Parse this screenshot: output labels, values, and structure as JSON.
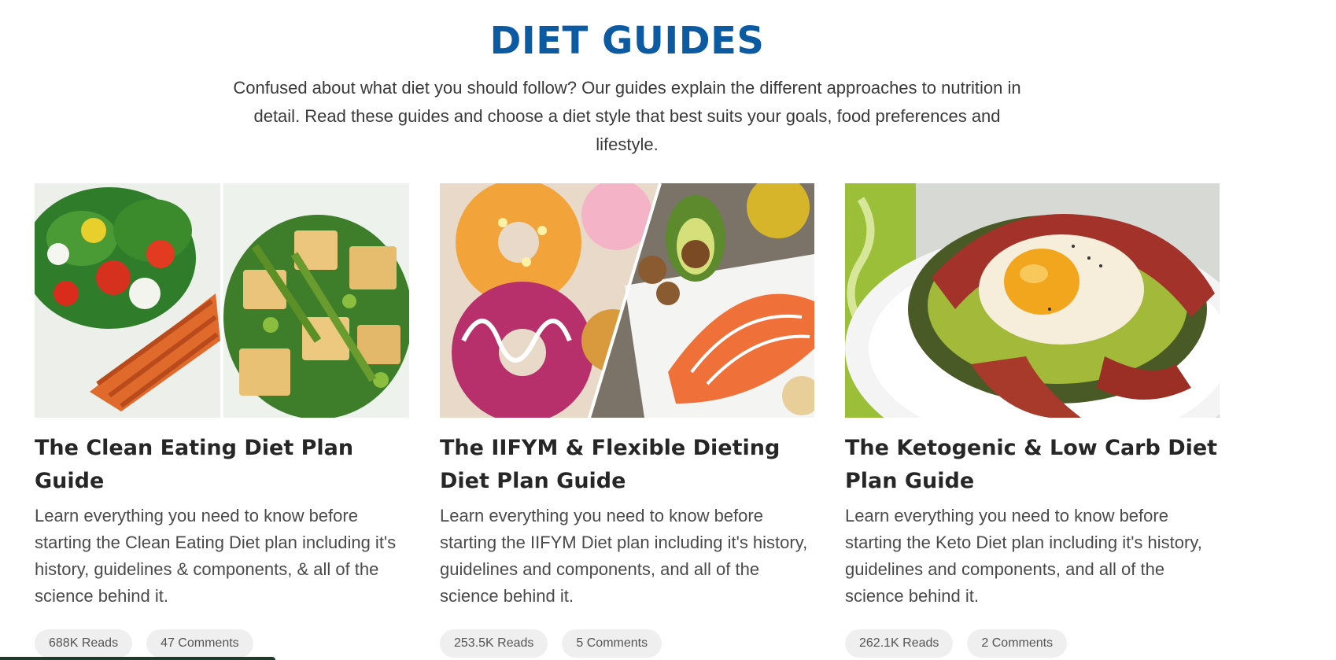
{
  "header": {
    "title": "DIET GUIDES",
    "intro": "Confused about what diet you should follow? Our guides explain the different approaches to nutrition in detail. Read these guides and choose a diet style that best suits your goals, food preferences and lifestyle."
  },
  "cards": [
    {
      "title": "The Clean Eating Diet Plan Guide",
      "description": "Learn everything you need to know before starting the Clean Eating Diet plan including it's history, guidelines & components, & all of the science behind it.",
      "reads": "688K Reads",
      "comments": "47 Comments",
      "image_icon": "salmon-salad-tofu-photo"
    },
    {
      "title": "The IIFYM & Flexible Dieting Diet Plan Guide",
      "description": "Learn everything you need to know before starting the IIFYM Diet plan including it's history, guidelines and components, and all of the science behind it.",
      "reads": "253.5K Reads",
      "comments": "5 Comments",
      "image_icon": "donuts-avocado-salmon-photo"
    },
    {
      "title": "The Ketogenic & Low Carb Diet Plan Guide",
      "description": "Learn everything you need to know before starting the Keto Diet plan including it's history, guidelines and components, and all of the science behind it.",
      "reads": "262.1K Reads",
      "comments": "2 Comments",
      "image_icon": "egg-avocado-bacon-photo"
    }
  ],
  "colors": {
    "title": "#0b5aa2",
    "pill_bg": "#efefef",
    "text": "#4a4a4a"
  }
}
